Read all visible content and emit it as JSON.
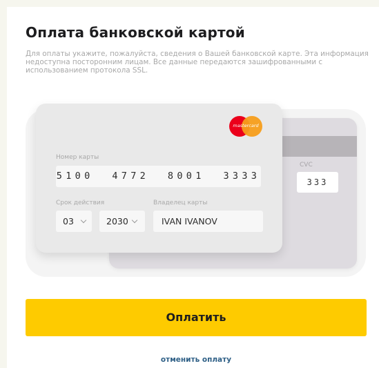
{
  "page": {
    "title": "Оплата банковской картой",
    "description": "Для оплаты укажите, пожалуйста, сведения о Вашей банковской карте. Эта информация недоступна посторонним лицам. Все данные передаются зашифрованными с использованием протокола SSL."
  },
  "card": {
    "brand_logo_text": "mastercard",
    "number_label": "Номер карты",
    "number_value": "5100  4772  8001  3333",
    "expiry_label": "Срок действия",
    "expiry_month": "03",
    "expiry_year": "2030",
    "holder_label": "Владелец карты",
    "holder_value": "IVAN IVANOV",
    "cvc_label": "CVC",
    "cvc_value": "333"
  },
  "actions": {
    "pay_label": "Оплатить",
    "cancel_label": "отменить оплату"
  },
  "colors": {
    "accent": "#fecb00",
    "link": "#2e5f86",
    "mastercard_red": "#eb001b",
    "mastercard_orange": "#f79e1b"
  },
  "icons": {
    "brand": "mastercard-logo-icon",
    "dropdown": "chevron-down-icon"
  }
}
